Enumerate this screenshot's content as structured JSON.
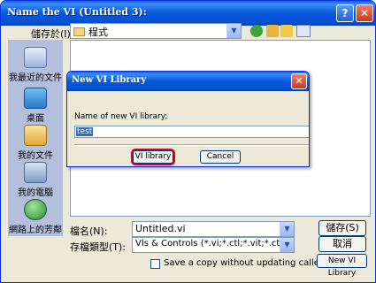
{
  "window": {
    "title": "Name the VI (Untitled 3):",
    "help_glyph": "?",
    "close_glyph": "✕"
  },
  "toolbar": {
    "save_in_label": "儲存於(I):",
    "save_in_value": "程式"
  },
  "places": {
    "items": [
      {
        "label": "我最近的文件",
        "icon": "recent-documents-icon"
      },
      {
        "label": "桌面",
        "icon": "desktop-icon"
      },
      {
        "label": "我的文件",
        "icon": "my-documents-icon"
      },
      {
        "label": "我的電腦",
        "icon": "my-computer-icon"
      },
      {
        "label": "網路上的芳鄰",
        "icon": "network-places-icon"
      }
    ]
  },
  "form": {
    "filename_label": "檔名(N):",
    "filename_value": "Untitled.vi",
    "filetype_label": "存檔類型(T):",
    "filetype_value": "VIs & Controls (*.vi;*.ctl;*.vit;*.ctt)",
    "save_button": "儲存(S)",
    "cancel_button": "取消",
    "checkbox_label": "Save a copy without updating callers.",
    "new_library_button": "New VI Library"
  },
  "modal": {
    "title": "New VI Library",
    "close_glyph": "✕",
    "field_label": "Name of new VI library:",
    "field_value": "test",
    "vi_library_button": "VI library",
    "cancel_button": "Cancel"
  },
  "colors": {
    "titlebar": "#0758dc",
    "dialog_bg": "#ece9d8",
    "places_bg": "#b3bfdc",
    "highlight_outline": "#d8001a"
  }
}
